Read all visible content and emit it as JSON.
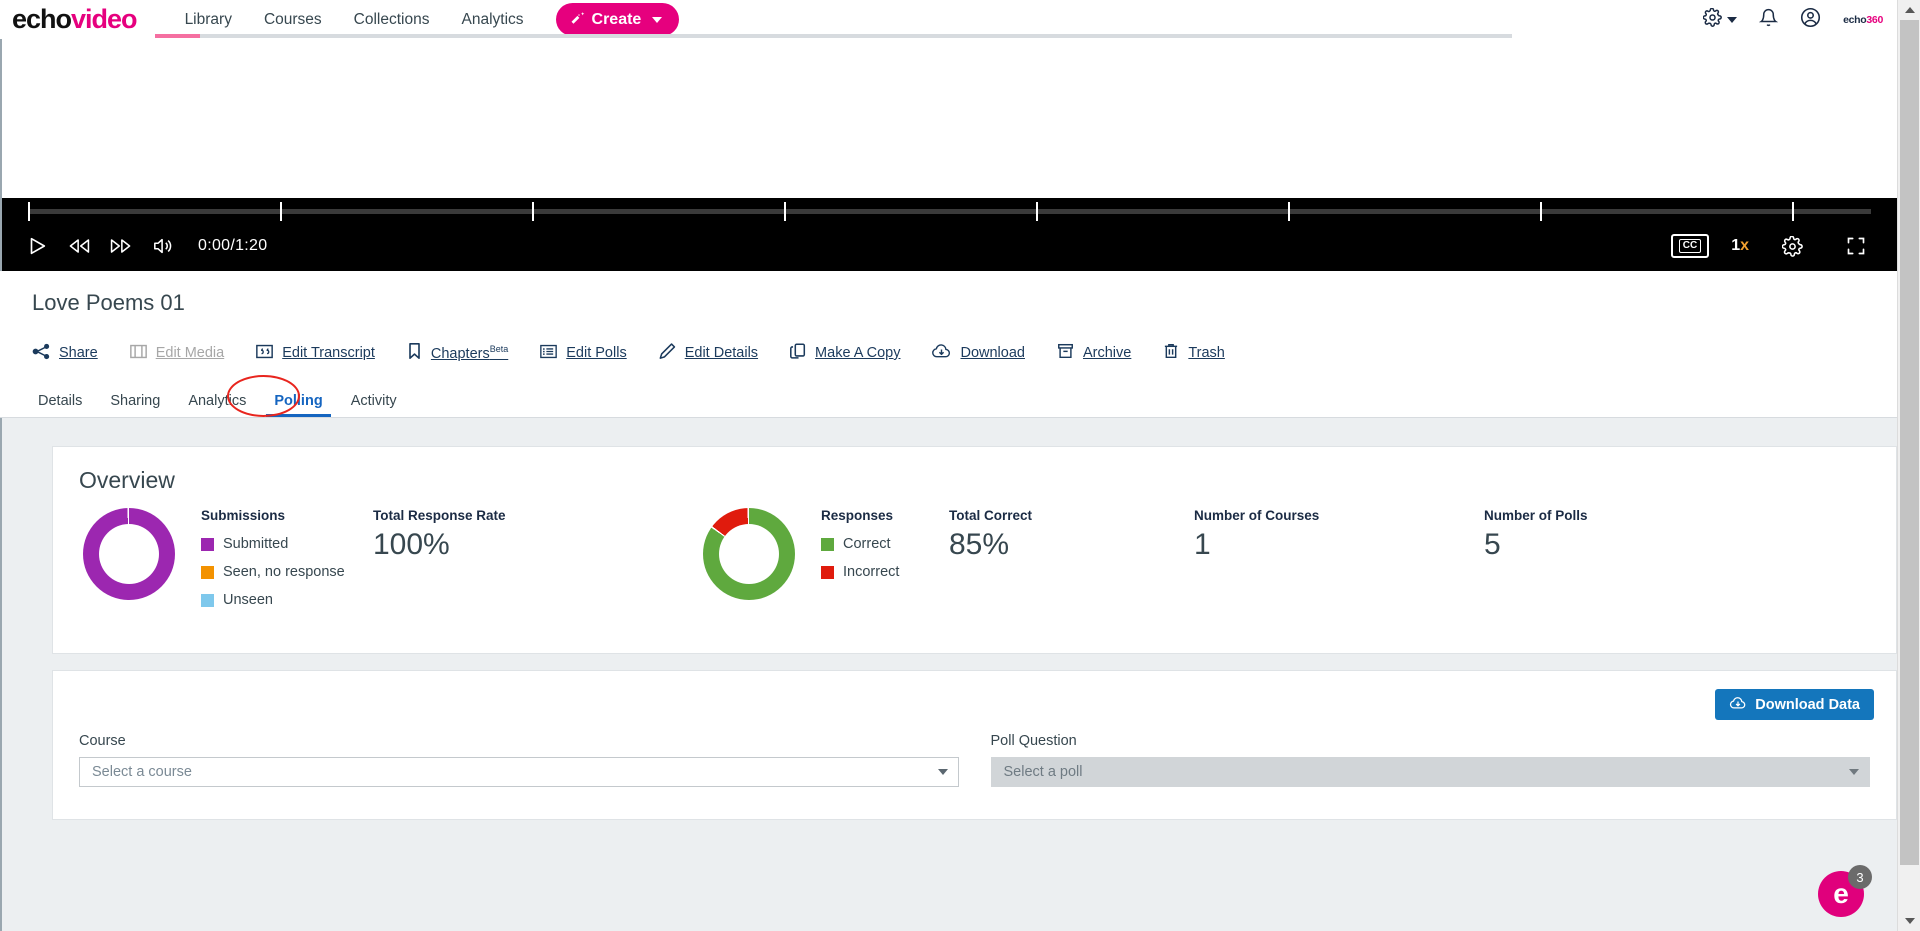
{
  "header": {
    "logo_echo": "echo",
    "logo_video": "video",
    "nav": [
      {
        "label": "Library"
      },
      {
        "label": "Courses"
      },
      {
        "label": "Collections"
      },
      {
        "label": "Analytics"
      }
    ],
    "create_label": "Create",
    "brand_mark_echo": "echo",
    "brand_mark_360": "360"
  },
  "player": {
    "time": "0:00/1:20",
    "cc_label": "CC",
    "speed": "1",
    "speed_suffix": "x"
  },
  "media": {
    "title": "Love Poems 01"
  },
  "actions": [
    {
      "label": "Share",
      "icon": "share-icon",
      "disabled": false
    },
    {
      "label": "Edit Media",
      "icon": "film-icon",
      "disabled": true
    },
    {
      "label": "Edit Transcript",
      "icon": "quote-icon",
      "disabled": false
    },
    {
      "label": "Chapters",
      "icon": "bookmark-icon",
      "badge": "Beta",
      "disabled": false
    },
    {
      "label": "Edit Polls",
      "icon": "list-icon",
      "disabled": false
    },
    {
      "label": "Edit Details",
      "icon": "pencil-icon",
      "disabled": false
    },
    {
      "label": "Make A Copy",
      "icon": "copy-icon",
      "disabled": false
    },
    {
      "label": "Download",
      "icon": "cloud-download-icon",
      "disabled": false
    },
    {
      "label": "Archive",
      "icon": "archive-icon",
      "disabled": false
    },
    {
      "label": "Trash",
      "icon": "trash-icon",
      "disabled": false
    }
  ],
  "tabs": [
    {
      "label": "Details",
      "active": false
    },
    {
      "label": "Sharing",
      "active": false
    },
    {
      "label": "Analytics",
      "active": false
    },
    {
      "label": "Polling",
      "active": true
    },
    {
      "label": "Activity",
      "active": false
    }
  ],
  "overview": {
    "title": "Overview",
    "submissions": {
      "legend_title": "Submissions",
      "items": [
        {
          "label": "Submitted",
          "color": "#9c27b0"
        },
        {
          "label": "Seen, no response",
          "color": "#f39200"
        },
        {
          "label": "Unseen",
          "color": "#7ec8ec"
        }
      ]
    },
    "responses": {
      "legend_title": "Responses",
      "items": [
        {
          "label": "Correct",
          "color": "#5fa93e"
        },
        {
          "label": "Incorrect",
          "color": "#e01b0d"
        }
      ]
    },
    "stats": [
      {
        "label": "Total Response Rate",
        "value": "100%"
      },
      {
        "label": "Total Correct",
        "value": "85%"
      },
      {
        "label": "Number of Courses",
        "value": "1"
      },
      {
        "label": "Number of Polls",
        "value": "5"
      }
    ]
  },
  "chart_data": [
    {
      "type": "pie",
      "title": "Submissions",
      "labels": [
        "Submitted",
        "Seen, no response",
        "Unseen"
      ],
      "values": [
        100,
        0,
        0
      ],
      "colors": [
        "#9c27b0",
        "#f39200",
        "#7ec8ec"
      ],
      "legend": "right",
      "donut": true
    },
    {
      "type": "pie",
      "title": "Responses",
      "labels": [
        "Correct",
        "Incorrect"
      ],
      "values": [
        85,
        15
      ],
      "colors": [
        "#5fa93e",
        "#e01b0d"
      ],
      "legend": "right",
      "donut": true
    }
  ],
  "filters": {
    "download_label": "Download Data",
    "course_label": "Course",
    "course_placeholder": "Select a course",
    "poll_label": "Poll Question",
    "poll_placeholder": "Select a poll"
  },
  "help": {
    "initial": "e",
    "badge": "3"
  }
}
